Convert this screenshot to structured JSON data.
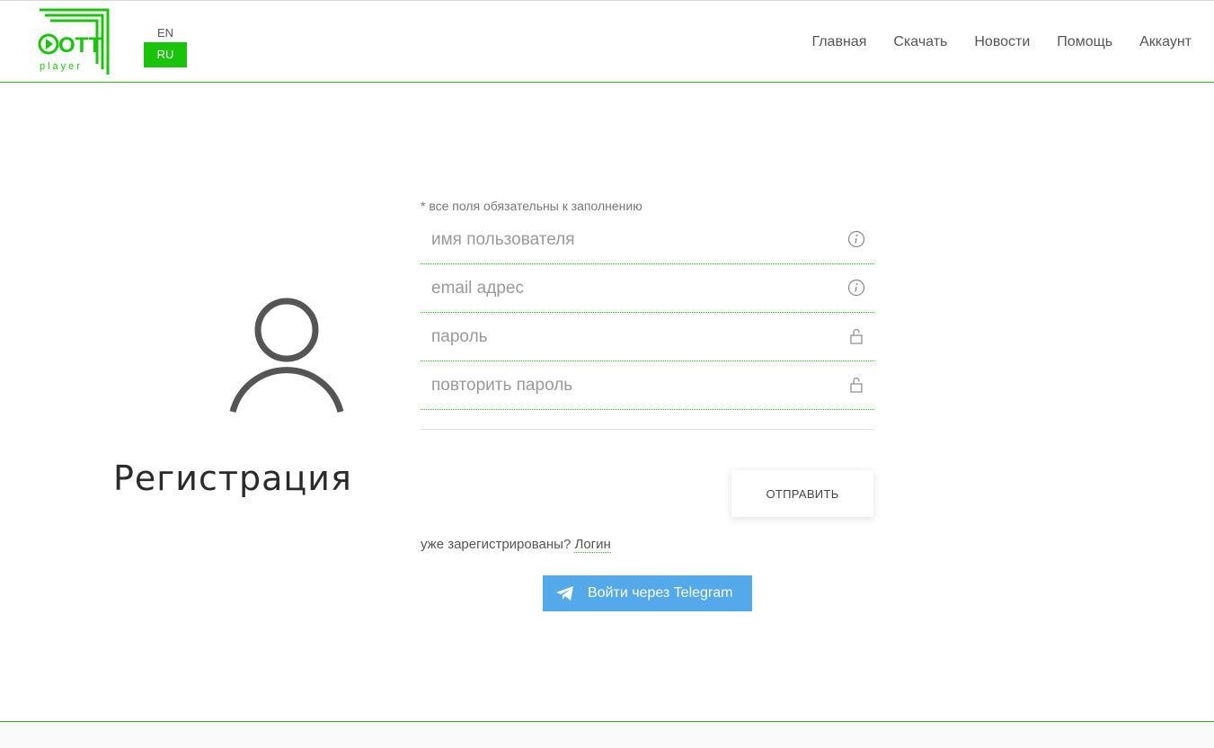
{
  "brand": {
    "logo_text": "OTT",
    "logo_sub": "player",
    "accent": "#19c40b",
    "line": "#2bbf1c"
  },
  "lang": {
    "en": "EN",
    "ru": "RU",
    "active": "RU"
  },
  "nav": {
    "items": [
      {
        "label": "Главная"
      },
      {
        "label": "Скачать"
      },
      {
        "label": "Новости"
      },
      {
        "label": "Помощь"
      },
      {
        "label": "Аккаунт"
      }
    ]
  },
  "page": {
    "title": "Регистрация"
  },
  "form": {
    "required_note": "* все поля обязательны к заполнению",
    "username": {
      "placeholder": "имя пользователя",
      "value": "",
      "icon": "info-icon"
    },
    "email": {
      "placeholder": "email адрес",
      "value": "",
      "icon": "info-icon"
    },
    "password": {
      "placeholder": "пароль",
      "value": "",
      "icon": "lock-icon"
    },
    "password_repeat": {
      "placeholder": "повторить пароль",
      "value": "",
      "icon": "lock-icon"
    },
    "submit_label": "ОТПРАВИТЬ",
    "already_text": "уже зарегистрированы?",
    "login_link": "Логин"
  },
  "telegram": {
    "label": "Войти через Telegram",
    "color": "#54a9eb"
  }
}
